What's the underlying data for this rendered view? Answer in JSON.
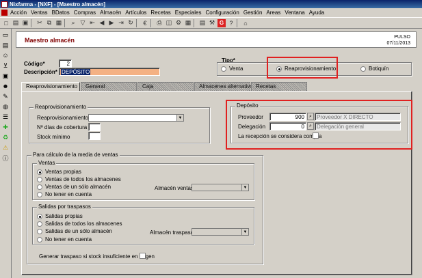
{
  "window": {
    "title": "Nixfarma - [NXF] - [Maestro almacén]"
  },
  "menu": [
    "Acción",
    "Ventas",
    "BDatos",
    "Compras",
    "Almacén",
    "Artículos",
    "Recetas",
    "Especiales",
    "Configuración",
    "Gestión",
    "Areas",
    "Ventana",
    "Ayuda"
  ],
  "header": {
    "title": "Maestro almacén",
    "user": "PULSO",
    "date": "07/11/2013"
  },
  "form": {
    "codigo_label": "Código*",
    "codigo_value": "2",
    "descripcion_label": "Descripción*",
    "descripcion_value": "DEPÓSITO"
  },
  "tipo": {
    "label": "Tipo*",
    "options": [
      "Venta",
      "Reaprovisionamiento",
      "Botiquín"
    ],
    "selected": "Reaprovisionamiento"
  },
  "tabs": [
    "Reaprovisionamiento",
    "General",
    "Caja",
    "Almacenes alternativos",
    "Recetas"
  ],
  "reapro": {
    "group_title": "Reaprovisionamiento",
    "reapro_label": "Reaprovisionamiento",
    "dias_label": "Nº días de cobertura",
    "stock_label": "Stock mínimo"
  },
  "deposito": {
    "group_title": "Depósito",
    "proveedor_label": "Proveedor",
    "proveedor_code": "900",
    "proveedor_name": "Proveedor X DIRECTO",
    "delegacion_label": "Delegación",
    "delegacion_code": "0",
    "delegacion_name": "Delegación general",
    "recepcion_label": "La recepción se considera compra"
  },
  "calculo": {
    "group_title": "Para cálculo de la media de ventas",
    "ventas": {
      "title": "Ventas",
      "options": [
        "Ventas propias",
        "Ventas de todos los almacenes",
        "Ventas de un sólo almacén",
        "No tener en cuenta"
      ],
      "selected": "Ventas propias",
      "almacen_label": "Almacén ventas"
    },
    "salidas": {
      "title": "Salidas por traspasos",
      "options": [
        "Salidas propias",
        "Salidas de todos los almacenes",
        "Salidas de un sólo almacén",
        "No tener en cuenta"
      ],
      "selected": "Salidas propias",
      "almacen_label": "Almacén traspaso"
    }
  },
  "generar_label": "Generar traspaso si stock insuficiente en origen",
  "colors": {
    "highlight": "#e02020",
    "title": "#800000",
    "desc_bg": "#f4b183"
  }
}
